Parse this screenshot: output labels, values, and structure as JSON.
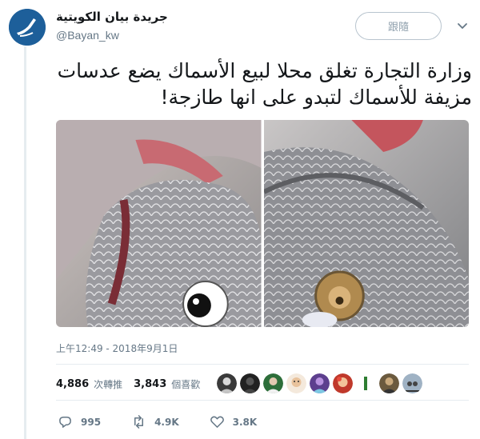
{
  "account": {
    "name": "جريدة بيان الكويتية",
    "handle": "@Bayan_kw",
    "follow_label": "跟隨"
  },
  "tweet": {
    "text_line1": "وزارة التجارة تغلق محلا لبيع الأسماك يضع عدسات",
    "text_line2": "مزيفة للأسماك لتبدو على انها طازجة!",
    "timestamp": "上午12:49 - 2018年9月1日"
  },
  "stats": {
    "retweets": "4,886",
    "retweets_label": "次轉推",
    "likes": "3,843",
    "likes_label": "個喜歡"
  },
  "actions": {
    "replies": "995",
    "retweets": "4.9K",
    "likes": "3.8K"
  },
  "colors": {
    "brand_blue": "#1d5f9a",
    "secondary_text": "#657786",
    "divider": "#e6ecf0"
  }
}
